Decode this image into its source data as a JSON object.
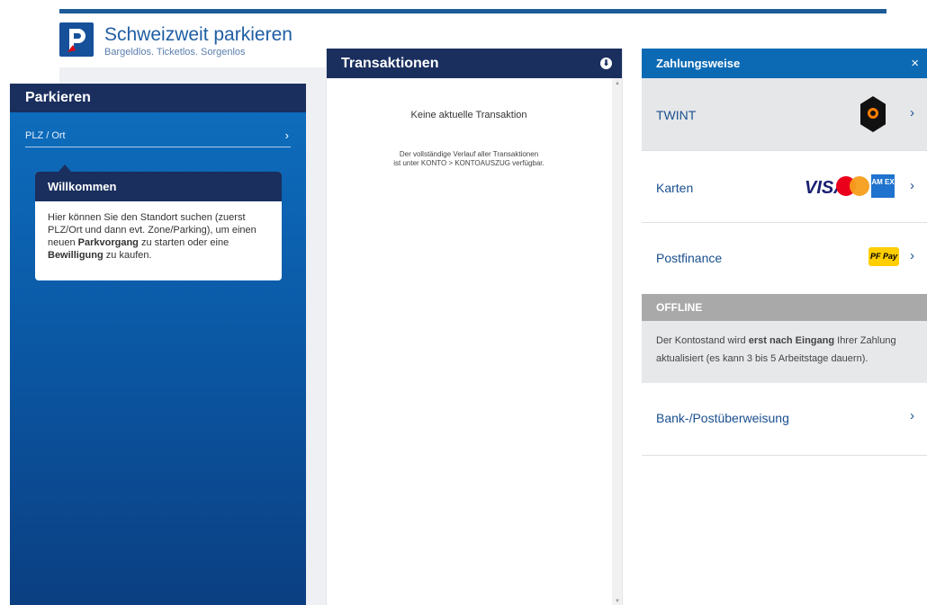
{
  "app": {
    "title": "Schweizweit parkieren",
    "subtitle": "Bargeldlos. Ticketlos. Sorgenlos",
    "brand_color": "#1b5c98"
  },
  "parkieren": {
    "title": "Parkieren",
    "location_field": "PLZ / Ort",
    "welcome": {
      "title": "Willkommen",
      "text_1": "Hier können Sie den Standort suchen (zuerst PLZ/Ort und dann evt. Zone/Parking), um einen neuen ",
      "strong_1": "Parkvorgang",
      "text_2": " zu starten oder eine ",
      "strong_2": "Bewilligung",
      "text_3": " zu kaufen."
    }
  },
  "transaktionen": {
    "title": "Transaktionen",
    "empty": "Keine aktuelle Transaktion",
    "note_line1": "Der vollständige Verlauf aller Transaktionen",
    "note_line2": "ist unter KONTO > KONTOAUSZUG verfügbar."
  },
  "zahlungsweise": {
    "title": "Zahlungsweise",
    "close": "×",
    "methods": [
      {
        "label": "TWINT",
        "icon": "twint-logo-icon"
      },
      {
        "label": "Karten",
        "icons": [
          "visa-logo-icon",
          "mastercard-logo-icon",
          "amex-logo-icon"
        ],
        "amex_text": "AM EX",
        "visa_text": "VISA"
      },
      {
        "label": "Postfinance",
        "icon": "pfpay-logo-icon",
        "pfpay_text": "PF Pay"
      }
    ],
    "offline": {
      "label": "OFFLINE",
      "note_pre": "Der Kontostand wird ",
      "note_strong": "erst nach Eingang",
      "note_post": " Ihrer Zahlung aktualisiert (es kann 3 bis 5 Arbeitstage dauern)."
    },
    "bank": {
      "label": "Bank-/Postüberweisung"
    }
  }
}
